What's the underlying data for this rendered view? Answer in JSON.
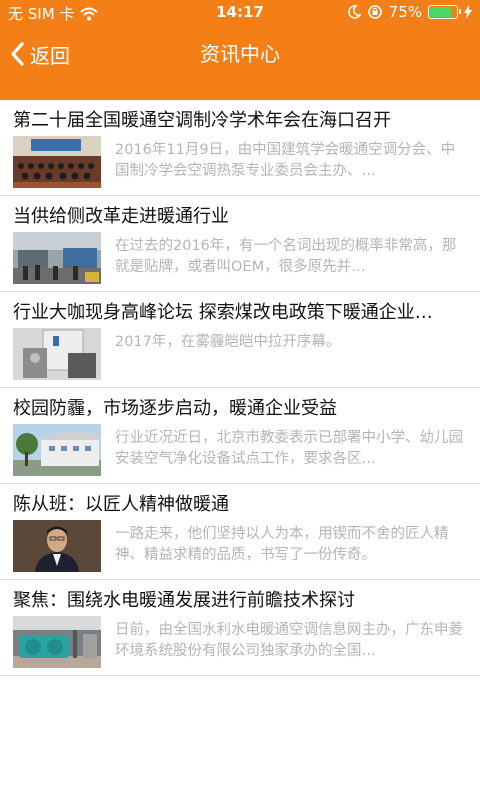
{
  "status": {
    "carrier": "无 SIM 卡",
    "time": "14:17",
    "battery_pct": "75%",
    "battery_level": 0.75
  },
  "nav": {
    "back_label": "返回",
    "title": "资讯中心"
  },
  "articles": [
    {
      "title": "第二十届全国暖通空调制冷学术年会在海口召开",
      "summary": "2016年11月9日，由中国建筑学会暖通空调分会、中国制冷学会空调热泵专业委员会主办、…",
      "thumb": "conference-photo"
    },
    {
      "title": "当供给侧改革走进暖通行业",
      "summary": "在过去的2016年，有一个名词出现的概率非常高，那就是贴牌，或者叫OEM，很多原先并…",
      "thumb": "factory-tour-photo"
    },
    {
      "title": "行业大咖现身高峰论坛 探索煤改电政策下暖通企业…",
      "summary": "2017年，在雾霾皑皑中拉开序幕。",
      "thumb": "equipment-photo"
    },
    {
      "title": "校园防霾，市场逐步启动，暖通企业受益",
      "summary": "行业近况近日，北京市教委表示已部署中小学、幼儿园安装空气净化设备试点工作，要求各区…",
      "thumb": "school-building-photo"
    },
    {
      "title": "陈从班：以匠人精神做暖通",
      "summary": "一路走来，他们坚持以人为本，用锲而不舍的匠人精神、精益求精的品质，书写了一份传奇。",
      "thumb": "portrait-photo"
    },
    {
      "title": "聚焦：围绕水电暖通发展进行前瞻技术探讨",
      "summary": "日前，由全国水利水电暖通空调信息网主办，广东申菱环境系统股份有限公司独家承办的全国…",
      "thumb": "machinery-photo"
    }
  ]
}
